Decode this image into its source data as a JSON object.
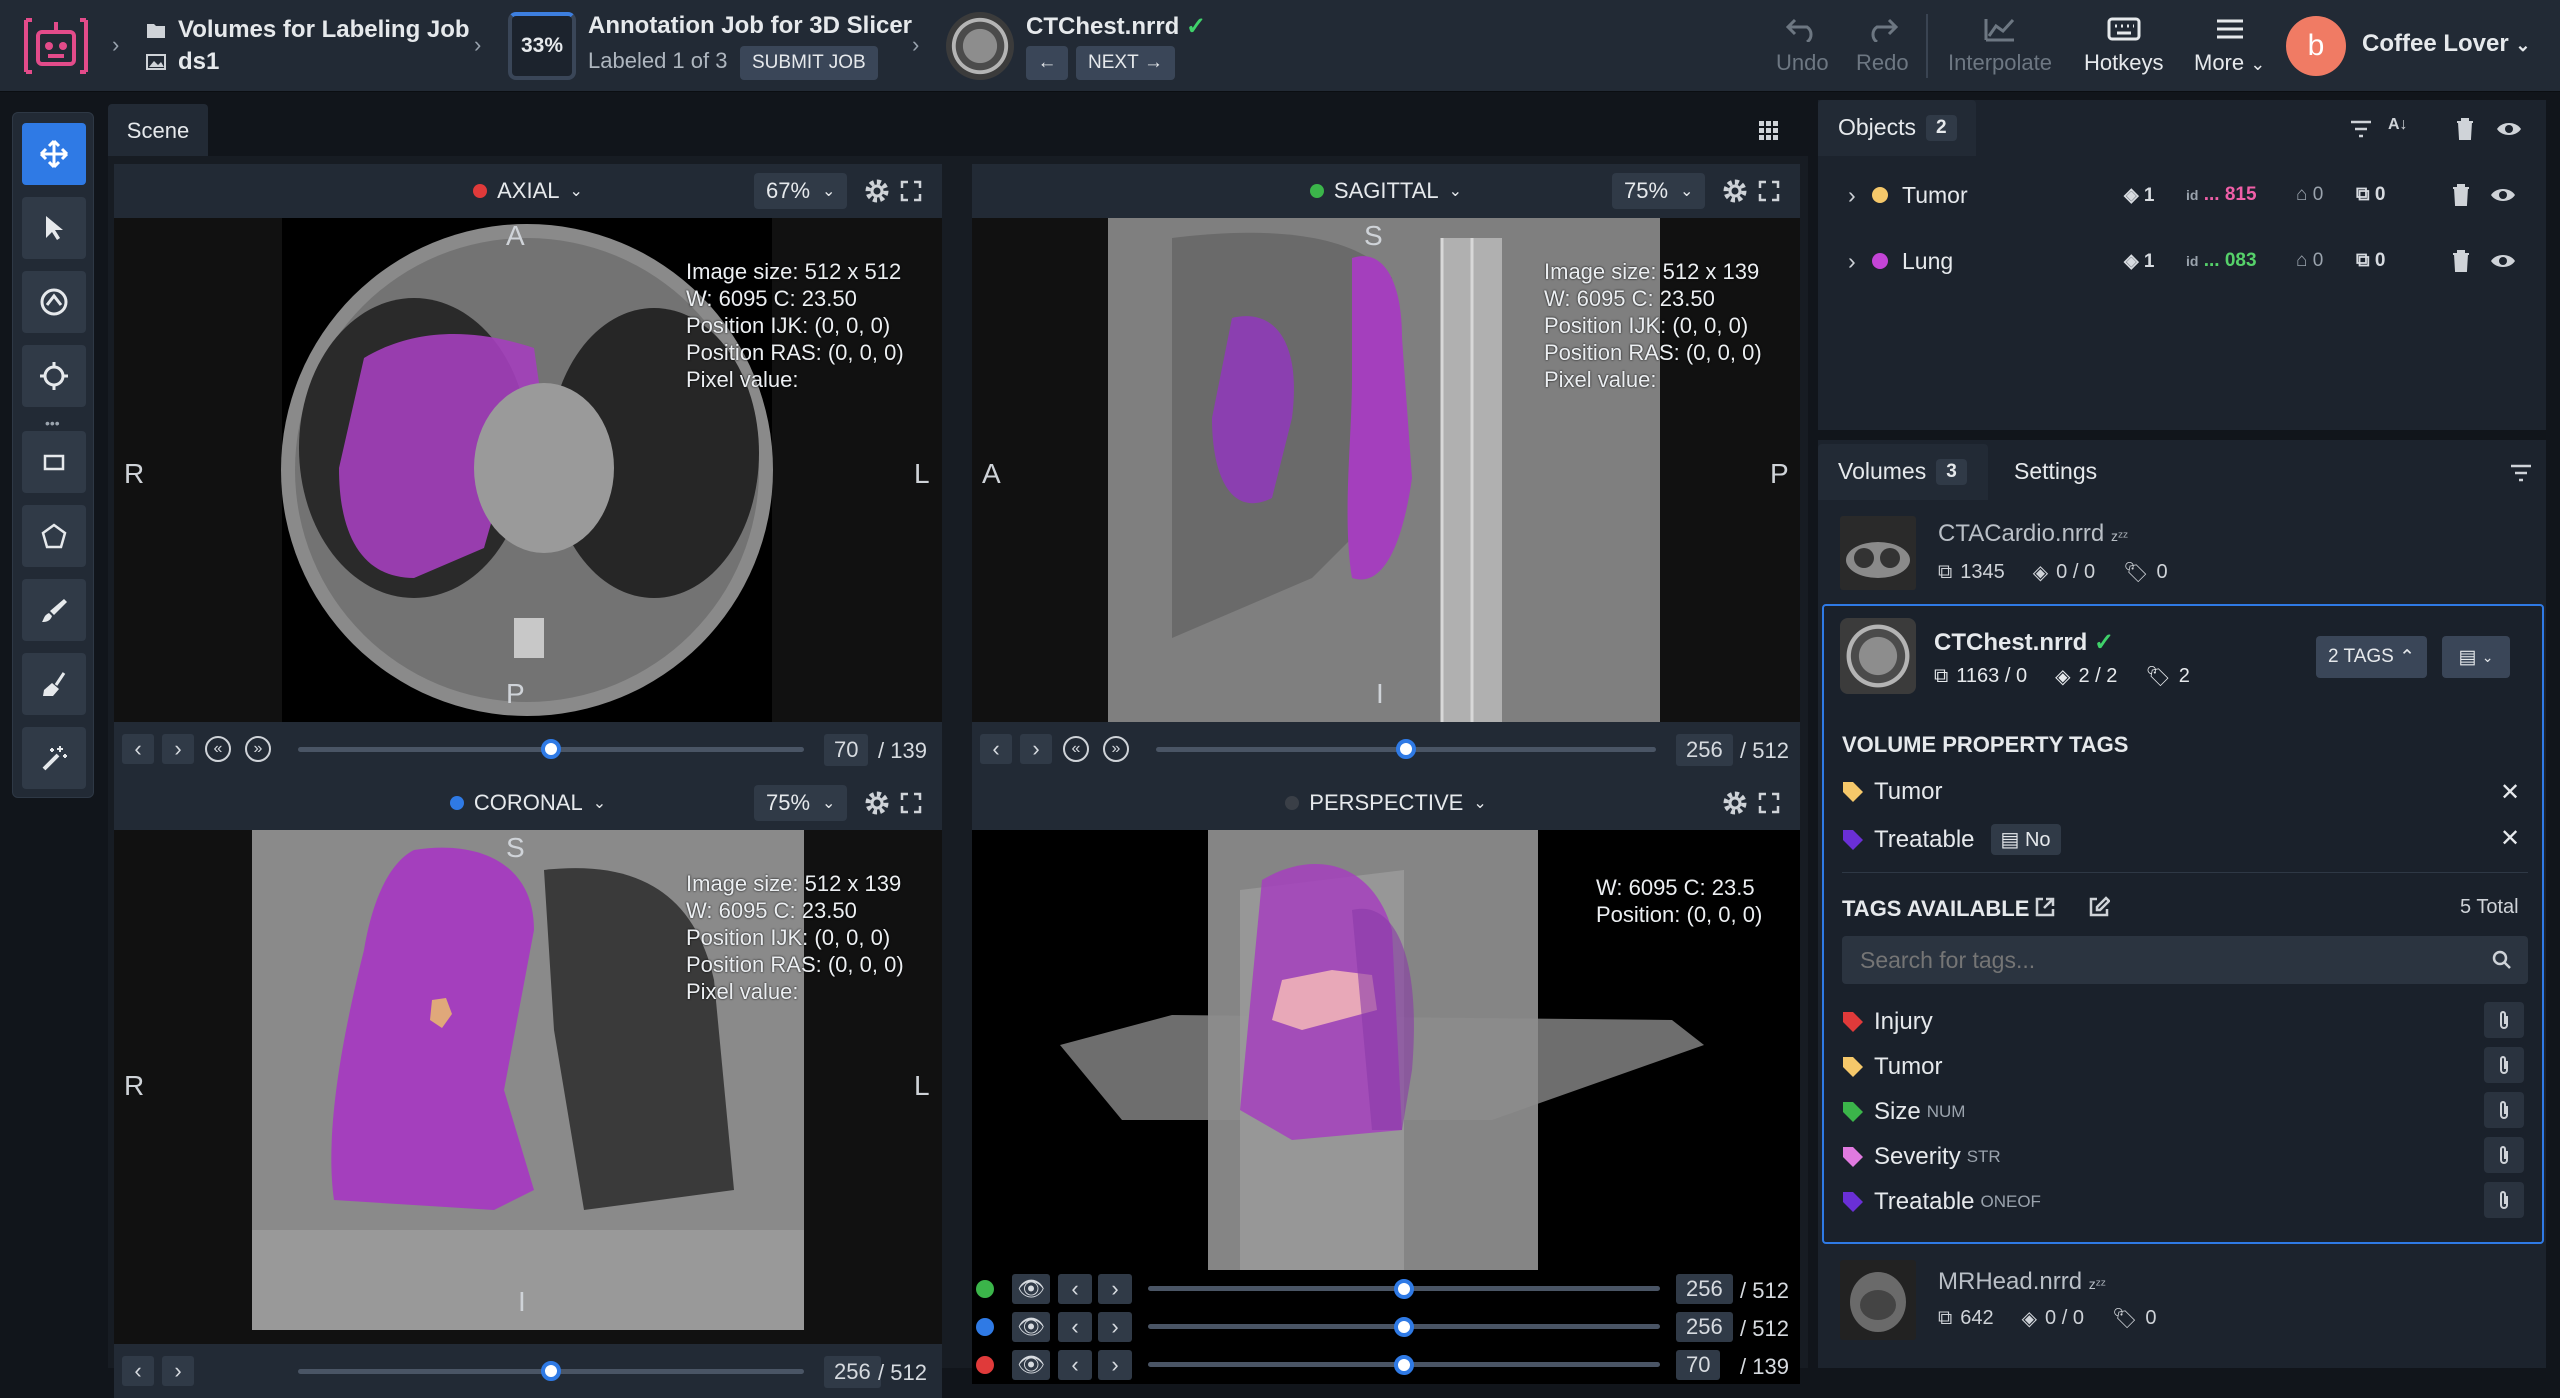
{
  "header": {
    "crumb_title": "Volumes for Labeling Job",
    "crumb_dataset": "ds1",
    "progress": "33%",
    "job_title": "Annotation Job for 3D Slicer",
    "job_sub": "Labeled 1 of 3",
    "submit": "SUBMIT JOB",
    "volume_name": "CTChest.nrrd",
    "next": "NEXT",
    "undo": "Undo",
    "redo": "Redo",
    "interpolate": "Interpolate",
    "hotkeys": "Hotkeys",
    "more": "More",
    "avatar_letter": "b",
    "user": "Coffee Lover"
  },
  "scene_tab": "Scene",
  "views": {
    "axial": {
      "name": "AXIAL",
      "zoom": "67%",
      "top": "A",
      "bottom": "P",
      "left": "R",
      "right": "L",
      "info": [
        "Image size: 512 x 512",
        "W: 6095 C: 23.50",
        "Position IJK: (0, 0, 0)",
        "Position RAS: (0, 0, 0)",
        "Pixel value:"
      ],
      "slice": "70",
      "total": "/ 139",
      "slider_pos": 0.5
    },
    "sagittal": {
      "name": "SAGITTAL",
      "zoom": "75%",
      "top": "S",
      "bottom": "I",
      "left": "A",
      "right": "P",
      "info": [
        "Image size: 512 x 139",
        "W: 6095 C: 23.50",
        "Position IJK: (0, 0, 0)",
        "Position RAS: (0, 0, 0)",
        "Pixel value:"
      ],
      "slice": "256",
      "total": "/ 512",
      "slider_pos": 0.5
    },
    "coronal": {
      "name": "CORONAL",
      "zoom": "75%",
      "top": "S",
      "bottom": "I",
      "left": "R",
      "right": "L",
      "info": [
        "Image size: 512 x 139",
        "W: 6095 C: 23.50",
        "Position IJK: (0, 0, 0)",
        "Position RAS: (0, 0, 0)",
        "Pixel value:"
      ],
      "slice": "256",
      "total": "/ 512",
      "slider_pos": 0.5
    },
    "perspective": {
      "name": "PERSPECTIVE",
      "info": [
        "W: 6095 C: 23.5",
        "Position: (0, 0, 0)"
      ],
      "sliders": [
        {
          "color": "#3bb54a",
          "value": "256",
          "total": "/ 512",
          "pos": 0.5
        },
        {
          "color": "#2f7ae5",
          "value": "256",
          "total": "/ 512",
          "pos": 0.5
        },
        {
          "color": "#e03a3a",
          "value": "70",
          "total": "/ 139",
          "pos": 0.5
        }
      ]
    }
  },
  "objects": {
    "title": "Objects",
    "count": "2",
    "items": [
      {
        "name": "Tumor",
        "color": "#f5c86a",
        "layers": "1",
        "id": "... 815",
        "id_color": "#f05fa8",
        "tags": "0",
        "frames": "0"
      },
      {
        "name": "Lung",
        "color": "#c344d6",
        "layers": "1",
        "id": "... 083",
        "id_color": "#56d16a",
        "tags": "0",
        "frames": "0"
      }
    ]
  },
  "volumes": {
    "title": "Volumes",
    "count": "3",
    "settings": "Settings",
    "items": [
      {
        "name": "CTACardio.nrrd",
        "frames": "1345",
        "objects": "0 / 0",
        "tags": "0"
      },
      {
        "name": "CTChest.nrrd",
        "frames": "1163 / 0",
        "objects": "2 / 2",
        "tags": "2",
        "tags_btn": "2 TAGS"
      },
      {
        "name": "MRHead.nrrd",
        "frames": "642",
        "objects": "0 / 0",
        "tags": "0"
      }
    ],
    "property_tags_title": "VOLUME PROPERTY TAGS",
    "property_tags": [
      {
        "name": "Tumor",
        "color": "#f5c86a"
      },
      {
        "name": "Treatable",
        "color": "#6a2fd6",
        "value": "No"
      }
    ],
    "available_title": "TAGS AVAILABLE",
    "available_total": "5 Total",
    "search_placeholder": "Search for tags...",
    "available": [
      {
        "name": "Injury",
        "color": "#e03a3a",
        "type": ""
      },
      {
        "name": "Tumor",
        "color": "#f5c86a",
        "type": ""
      },
      {
        "name": "Size",
        "color": "#3bb54a",
        "type": "NUM"
      },
      {
        "name": "Severity",
        "color": "#e07ae0",
        "type": "STR"
      },
      {
        "name": "Treatable",
        "color": "#6a2fd6",
        "type": "ONEOF"
      }
    ]
  }
}
